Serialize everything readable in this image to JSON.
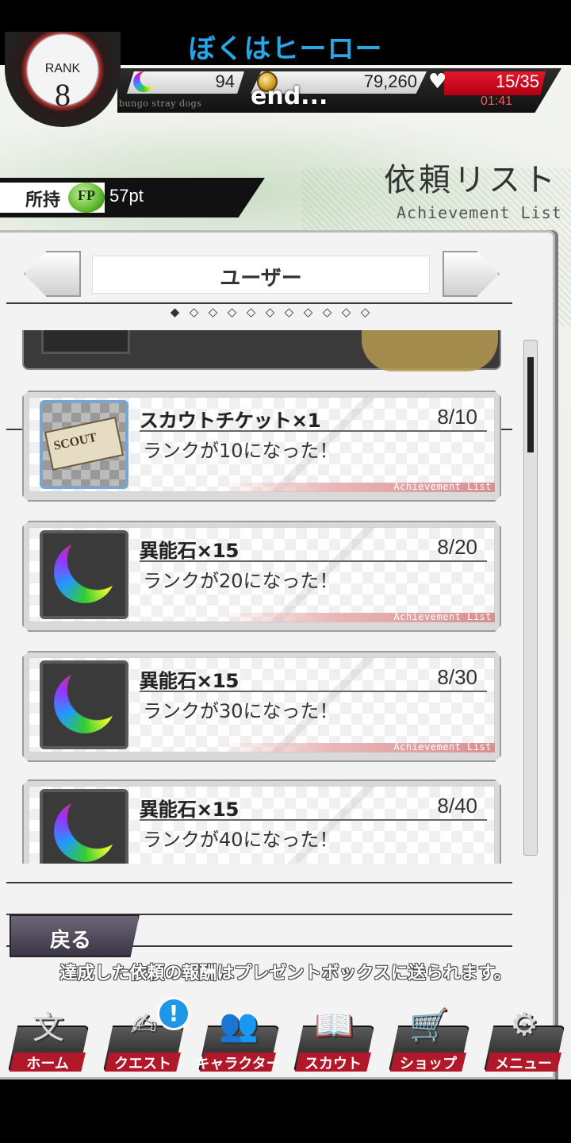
{
  "statusbar": {
    "title": "ぼくはヒーロー"
  },
  "hud": {
    "rank_label": "RANK",
    "rank_value": "8",
    "stones": "94",
    "coins": "79,260",
    "ap": "15/35",
    "ap_timer": "01:41",
    "subtitle": "bungo stray dogs",
    "overlay_text": "end..."
  },
  "header": {
    "title_jp": "依頼リスト",
    "title_en": "Achievement List",
    "fp_label": "所持",
    "fp_badge": "FP",
    "fp_value": "57pt"
  },
  "tabs": {
    "current": "ユーザー",
    "dots": [
      "◆",
      "◇",
      "◇",
      "◇",
      "◇",
      "◇",
      "◇",
      "◇",
      "◇",
      "◇",
      "◇"
    ]
  },
  "achievements": [
    {
      "reward": "スカウトチケット×1",
      "condition": "ランクが10になった！",
      "progress": "8/10",
      "icon": "scout-ticket",
      "ticket_text": "SCOUT",
      "stripe": "Achievement List"
    },
    {
      "reward": "異能石×15",
      "condition": "ランクが20になった！",
      "progress": "8/20",
      "icon": "ability-stone",
      "stripe": "Achievement List"
    },
    {
      "reward": "異能石×15",
      "condition": "ランクが30になった！",
      "progress": "8/30",
      "icon": "ability-stone",
      "stripe": "Achievement List"
    },
    {
      "reward": "異能石×15",
      "condition": "ランクが40になった！",
      "progress": "8/40",
      "icon": "ability-stone",
      "stripe": ""
    }
  ],
  "footer": {
    "back_label": "戻る",
    "notice": "達成した依頼の報酬はプレゼントボックスに送られます。"
  },
  "nav": [
    {
      "label": "ホーム",
      "icon": "home-icon",
      "glyph": "文"
    },
    {
      "label": "クエスト",
      "icon": "quest-icon",
      "glyph": "✍"
    },
    {
      "label": "キャラクター",
      "icon": "character-icon",
      "glyph": "👥"
    },
    {
      "label": "スカウト",
      "icon": "scout-icon",
      "glyph": "📖"
    },
    {
      "label": "ショップ",
      "icon": "shop-icon",
      "glyph": "🛒"
    },
    {
      "label": "メニュー",
      "icon": "menu-icon",
      "glyph": "⚙"
    }
  ],
  "quest_badge": "!",
  "colors": {
    "accent_red": "#b1192a",
    "status_title": "#29a6e6",
    "ap_red": "#e5172b"
  }
}
